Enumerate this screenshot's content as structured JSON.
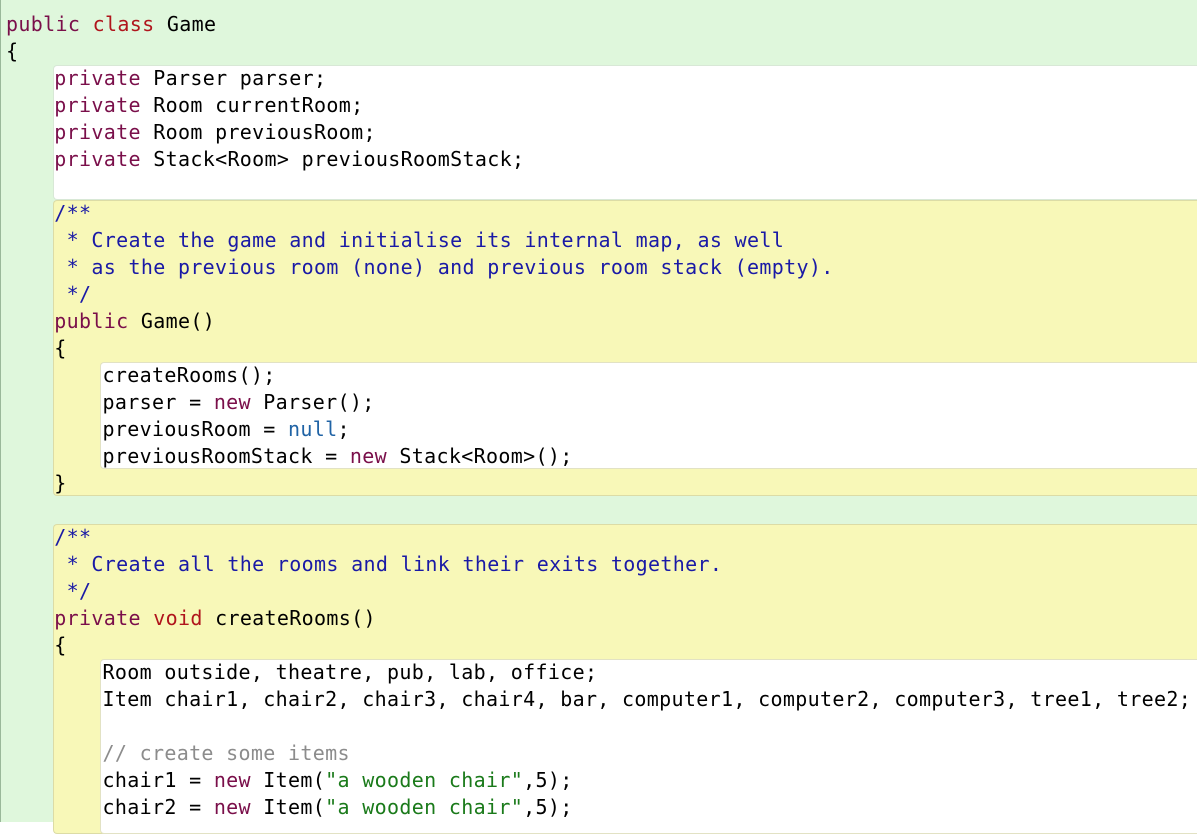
{
  "editor": {
    "lines": [
      {
        "indent": 0,
        "tokens": [
          {
            "t": "public",
            "c": "kw"
          },
          {
            "t": " "
          },
          {
            "t": "class",
            "c": "kw2"
          },
          {
            "t": " Game"
          }
        ]
      },
      {
        "indent": 0,
        "tokens": [
          {
            "t": "{"
          }
        ]
      },
      {
        "indent": 4,
        "tokens": [
          {
            "t": "private",
            "c": "kw"
          },
          {
            "t": " Parser parser;"
          }
        ]
      },
      {
        "indent": 4,
        "tokens": [
          {
            "t": "private",
            "c": "kw"
          },
          {
            "t": " Room currentRoom;"
          }
        ]
      },
      {
        "indent": 4,
        "tokens": [
          {
            "t": "private",
            "c": "kw"
          },
          {
            "t": " Room previousRoom;"
          }
        ]
      },
      {
        "indent": 4,
        "tokens": [
          {
            "t": "private",
            "c": "kw"
          },
          {
            "t": " Stack<Room> previousRoomStack;"
          }
        ]
      },
      {
        "indent": 0,
        "tokens": []
      },
      {
        "indent": 4,
        "tokens": [
          {
            "t": "/**",
            "c": "cm"
          }
        ]
      },
      {
        "indent": 4,
        "tokens": [
          {
            "t": " * Create the game and initialise its internal map, as well",
            "c": "cm"
          }
        ]
      },
      {
        "indent": 4,
        "tokens": [
          {
            "t": " * as the previous room (none) and previous room stack (empty).",
            "c": "cm"
          }
        ]
      },
      {
        "indent": 4,
        "tokens": [
          {
            "t": " */",
            "c": "cm"
          }
        ]
      },
      {
        "indent": 4,
        "tokens": [
          {
            "t": "public",
            "c": "kw"
          },
          {
            "t": " Game()"
          }
        ]
      },
      {
        "indent": 4,
        "tokens": [
          {
            "t": "{"
          }
        ]
      },
      {
        "indent": 8,
        "tokens": [
          {
            "t": "createRooms();"
          }
        ]
      },
      {
        "indent": 8,
        "tokens": [
          {
            "t": "parser = "
          },
          {
            "t": "new",
            "c": "kw"
          },
          {
            "t": " Parser();"
          }
        ]
      },
      {
        "indent": 8,
        "tokens": [
          {
            "t": "previousRoom = "
          },
          {
            "t": "null",
            "c": "lit"
          },
          {
            "t": ";"
          }
        ]
      },
      {
        "indent": 8,
        "tokens": [
          {
            "t": "previousRoomStack = "
          },
          {
            "t": "new",
            "c": "kw"
          },
          {
            "t": " Stack<Room>();"
          }
        ]
      },
      {
        "indent": 4,
        "tokens": [
          {
            "t": "}"
          }
        ]
      },
      {
        "indent": 0,
        "tokens": []
      },
      {
        "indent": 4,
        "tokens": [
          {
            "t": "/**",
            "c": "cm"
          }
        ]
      },
      {
        "indent": 4,
        "tokens": [
          {
            "t": " * Create all the rooms and link their exits together.",
            "c": "cm"
          }
        ]
      },
      {
        "indent": 4,
        "tokens": [
          {
            "t": " */",
            "c": "cm"
          }
        ]
      },
      {
        "indent": 4,
        "tokens": [
          {
            "t": "private",
            "c": "kw"
          },
          {
            "t": " "
          },
          {
            "t": "void",
            "c": "kw2"
          },
          {
            "t": " createRooms()"
          }
        ]
      },
      {
        "indent": 4,
        "tokens": [
          {
            "t": "{"
          }
        ]
      },
      {
        "indent": 8,
        "tokens": [
          {
            "t": "Room outside, theatre, pub, lab, office;"
          }
        ]
      },
      {
        "indent": 8,
        "tokens": [
          {
            "t": "Item chair1, chair2, chair3, chair4, bar, computer1, computer2, computer3, tree1, tree2;"
          }
        ]
      },
      {
        "indent": 0,
        "tokens": []
      },
      {
        "indent": 8,
        "tokens": [
          {
            "t": "// create some items",
            "c": "lc"
          }
        ]
      },
      {
        "indent": 8,
        "tokens": [
          {
            "t": "chair1 = "
          },
          {
            "t": "new",
            "c": "kw"
          },
          {
            "t": " Item("
          },
          {
            "t": "\"a wooden chair\"",
            "c": "str"
          },
          {
            "t": ",5);"
          }
        ]
      },
      {
        "indent": 8,
        "tokens": [
          {
            "t": "chair2 = "
          },
          {
            "t": "new",
            "c": "kw"
          },
          {
            "t": " Item("
          },
          {
            "t": "\"a wooden chair\"",
            "c": "str"
          },
          {
            "t": ",5);"
          }
        ]
      }
    ]
  },
  "colors": {
    "class_scope": "#dff7dc",
    "method_scope": "#f8f8b8",
    "keyword": "#7a0f4a",
    "keyword_type": "#b0151c",
    "comment": "#1a1aa6",
    "literal": "#2063a5",
    "string": "#1a7a1a"
  }
}
